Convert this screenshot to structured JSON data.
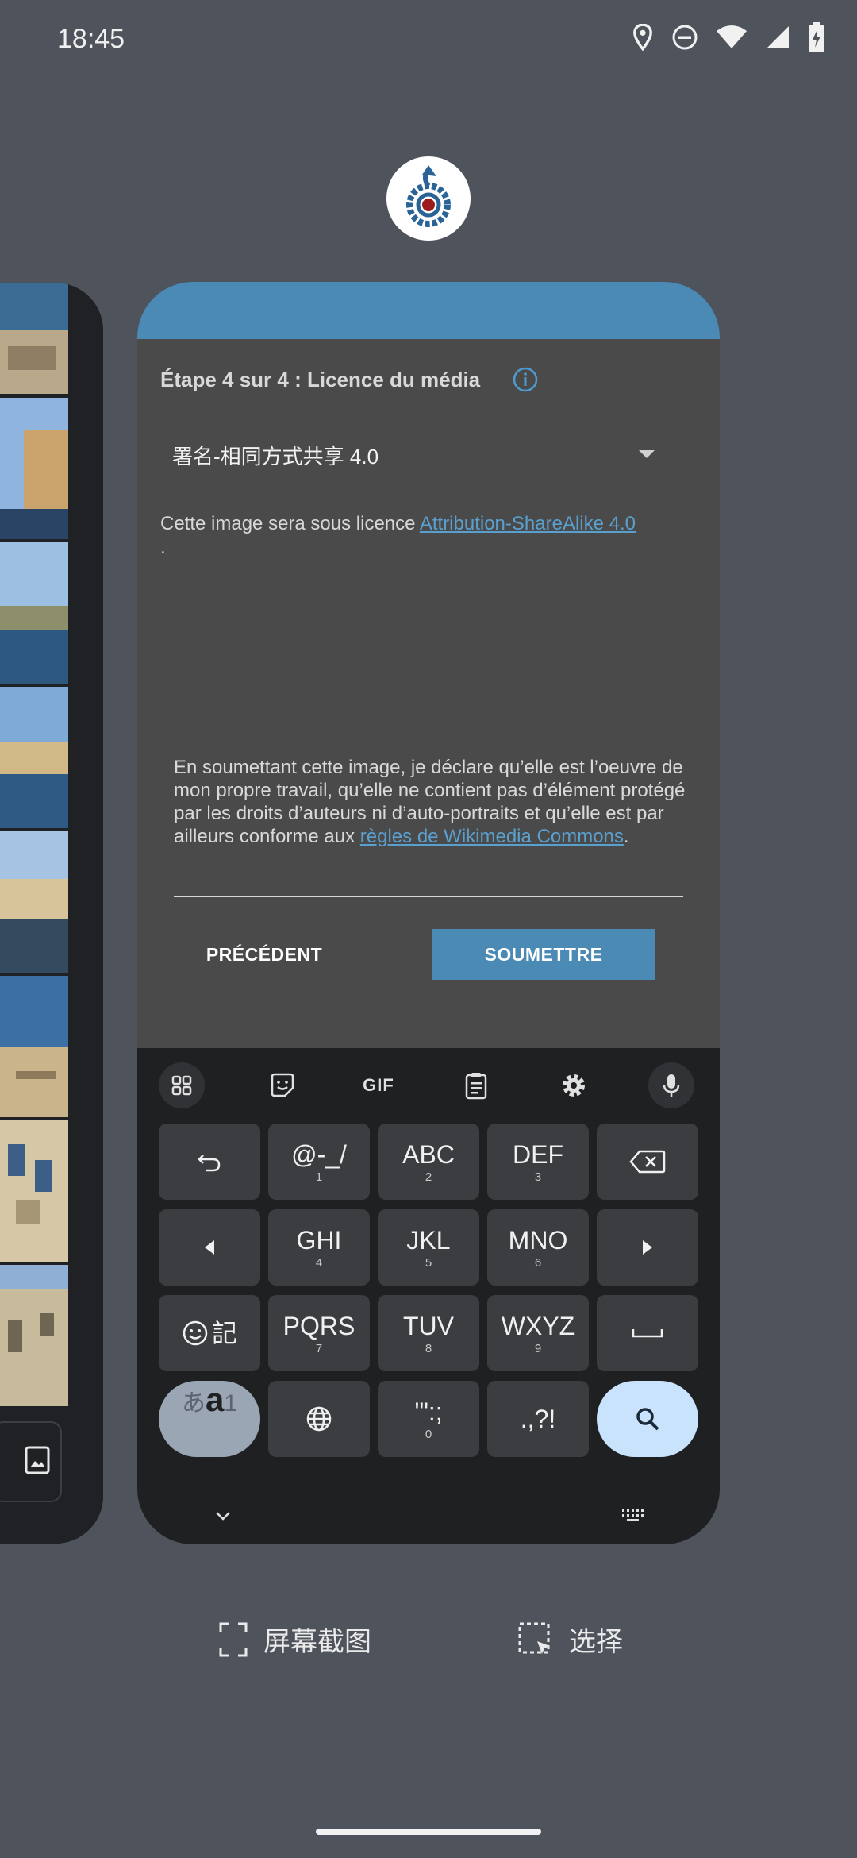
{
  "status": {
    "time": "18:45"
  },
  "form": {
    "step_title": "Étape 4 sur 4 : Licence du média",
    "license_value": "署名-相同方式共享 4.0",
    "license_text_prefix": "Cette image sera sous licence ",
    "license_link": "Attribution-ShareAlike 4.0",
    "license_text_suffix": ".",
    "declaration_text": "En soumettant cette image, je déclare qu’elle est l’oeuvre de mon propre travail, qu’elle ne contient pas d’élément protégé par les droits d’auteurs ni d’auto-portraits et qu’elle est par ailleurs conforme aux ",
    "declaration_link": "règles de Wikimedia Commons",
    "declaration_suffix": ".",
    "prev_label": "PRÉCÉDENT",
    "submit_label": "SOUMETTRE"
  },
  "keyboard": {
    "toolbar": {
      "gif": "GIF"
    },
    "keys": {
      "k1": {
        "main": "@-_/",
        "sub": "1"
      },
      "k2": {
        "main": "ABC",
        "sub": "2"
      },
      "k3": {
        "main": "DEF",
        "sub": "3"
      },
      "k4": {
        "main": "GHI",
        "sub": "4"
      },
      "k5": {
        "main": "JKL",
        "sub": "5"
      },
      "k6": {
        "main": "MNO",
        "sub": "6"
      },
      "k7": {
        "main": "PQRS",
        "sub": "7"
      },
      "k8": {
        "main": "TUV",
        "sub": "8"
      },
      "k9": {
        "main": "WXYZ",
        "sub": "9"
      },
      "k0": {
        "main": "'\":;",
        "sub": "0"
      },
      "punct": {
        "main": ".,?!"
      },
      "emoji_label": "記",
      "mode_a": "あ",
      "mode_b": "a",
      "mode_c": "1"
    }
  },
  "bottom_actions": {
    "screenshot_label": "屏幕截图",
    "select_label": "选择"
  },
  "colors": {
    "background": "#4f545c",
    "accent": "#4a8ab5",
    "card": "#4a4a4a",
    "keyboard": "#1f2022"
  }
}
